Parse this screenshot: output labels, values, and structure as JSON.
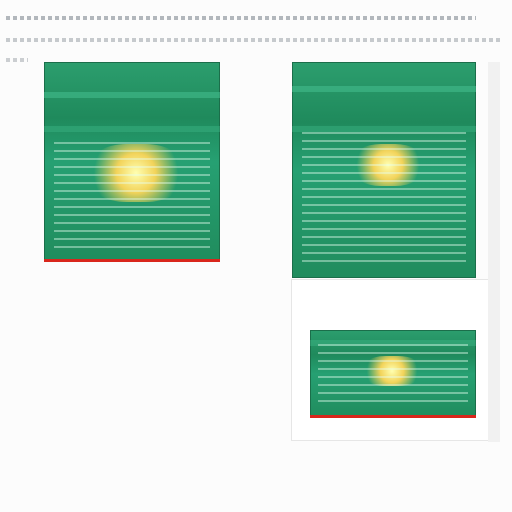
{
  "header": {
    "line1": "",
    "line2": "",
    "line3": ""
  },
  "left": {
    "thumbnail_title": "",
    "caption_heading": "",
    "caption_subheading": "",
    "caption_small": "",
    "link_text": "",
    "caption_after_link": "",
    "footnote": "",
    "meta_line": "",
    "code_line": ""
  },
  "right": {
    "thumbnail_title": "",
    "caption_heading": "",
    "caption_small": ""
  },
  "colors": {
    "thumbnail_green": "#1f8a5c",
    "thumbnail_highlight": "#f2d35a",
    "accent_bottom": "#d9261c",
    "link": "#a826b9"
  }
}
